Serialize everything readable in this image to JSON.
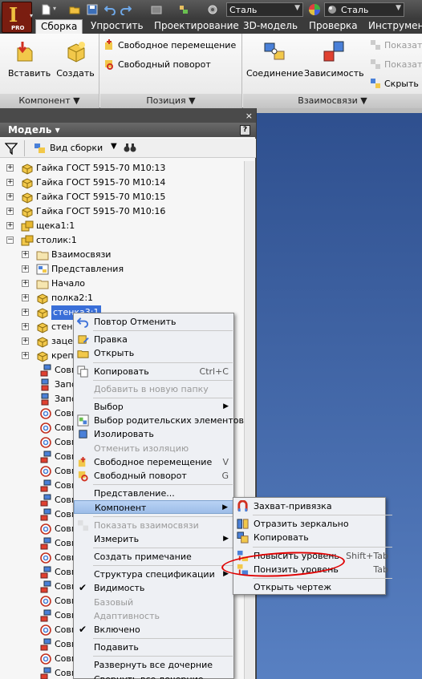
{
  "logo": {
    "letter": "I",
    "badge": "PRO"
  },
  "quick_access": {
    "material_combo": "Сталь",
    "appearance_combo": "Сталь"
  },
  "tabs": [
    "Сборка",
    "Упростить",
    "Проектирование",
    "3D-модель",
    "Проверка",
    "Инструмент"
  ],
  "ribbon": {
    "panel_component": {
      "label": "Компонент ▼",
      "insert": "Вставить",
      "create": "Создать"
    },
    "panel_position": {
      "label": "Позиция ▼",
      "free_move": "Свободное перемещение",
      "free_rotate": "Свободный поворот"
    },
    "panel_relations": {
      "label": "Взаимосвязи ▼",
      "joint": "Соединение",
      "constraint": "Зависимость",
      "show": "Показат",
      "show2": "Показат",
      "hide": "Скрыть"
    }
  },
  "browser": {
    "title": "Модель ▾",
    "close": "×",
    "help": "?",
    "view_label": "Вид сборки",
    "tree": [
      {
        "label": "Гайка ГОСТ 5915-70 М10:13",
        "level": 0,
        "icon": "part-icon"
      },
      {
        "label": "Гайка ГОСТ 5915-70 М10:14",
        "level": 0,
        "icon": "part-icon"
      },
      {
        "label": "Гайка ГОСТ 5915-70 М10:15",
        "level": 0,
        "icon": "part-icon"
      },
      {
        "label": "Гайка ГОСТ 5915-70 М10:16",
        "level": 0,
        "icon": "part-icon"
      },
      {
        "label": "щека1:1",
        "level": 0,
        "icon": "assembly-icon"
      },
      {
        "label": "столик:1",
        "level": 0,
        "icon": "assembly-icon",
        "expanded": true
      },
      {
        "label": "Взаимосвязи",
        "level": 1,
        "icon": "folder-icon"
      },
      {
        "label": "Представления",
        "level": 1,
        "icon": "representations-icon"
      },
      {
        "label": "Начало",
        "level": 1,
        "icon": "folder-icon"
      },
      {
        "label": "полка2:1",
        "level": 1,
        "icon": "part-icon"
      },
      {
        "label": "стенка3:1",
        "level": 1,
        "icon": "part-icon",
        "selected": true
      },
      {
        "label": "стен",
        "level": 1,
        "icon": "part-icon"
      },
      {
        "label": "зацеп",
        "level": 1,
        "icon": "part-icon"
      },
      {
        "label": "крепл",
        "level": 1,
        "icon": "part-icon"
      },
      {
        "label": "Совм",
        "level": 2,
        "icon": "mate-icon"
      },
      {
        "label": "Запол",
        "level": 2,
        "icon": "flush-icon"
      },
      {
        "label": "Запол",
        "level": 2,
        "icon": "flush-icon"
      },
      {
        "label": "Совм",
        "level": 2,
        "icon": "insert-constraint-icon"
      },
      {
        "label": "Совм",
        "level": 2,
        "icon": "insert-constraint-icon"
      },
      {
        "label": "Совм",
        "level": 2,
        "icon": "insert-constraint-icon"
      },
      {
        "label": "Совм",
        "level": 2,
        "icon": "mate-icon"
      },
      {
        "label": "Совм",
        "level": 2,
        "icon": "insert-constraint-icon"
      },
      {
        "label": "Совм",
        "level": 2,
        "icon": "mate-icon"
      },
      {
        "label": "Совм",
        "level": 2,
        "icon": "mate-icon"
      },
      {
        "label": "Совм",
        "level": 2,
        "icon": "mate-icon"
      },
      {
        "label": "Совм",
        "level": 2,
        "icon": "insert-constraint-icon"
      },
      {
        "label": "Совм",
        "level": 2,
        "icon": "mate-icon"
      },
      {
        "label": "Совм",
        "level": 2,
        "icon": "insert-constraint-icon"
      },
      {
        "label": "Совм",
        "level": 2,
        "icon": "mate-icon"
      },
      {
        "label": "Совм",
        "level": 2,
        "icon": "mate-icon"
      },
      {
        "label": "Совм",
        "level": 2,
        "icon": "insert-constraint-icon"
      },
      {
        "label": "Совм",
        "level": 2,
        "icon": "mate-icon"
      },
      {
        "label": "Совм",
        "level": 2,
        "icon": "insert-constraint-icon"
      },
      {
        "label": "Совм",
        "level": 2,
        "icon": "mate-icon"
      },
      {
        "label": "Совм",
        "level": 2,
        "icon": "insert-constraint-icon"
      },
      {
        "label": "Совм",
        "level": 2,
        "icon": "mate-icon"
      },
      {
        "label": "Совм",
        "level": 2,
        "icon": "mate-icon"
      }
    ]
  },
  "context_menu": {
    "items": [
      {
        "label": "Повтор Отменить",
        "icon": "undo-icon"
      },
      {
        "sep": true
      },
      {
        "label": "Правка",
        "icon": "edit-icon"
      },
      {
        "label": "Открыть",
        "icon": "open-icon"
      },
      {
        "sep": true
      },
      {
        "label": "Копировать",
        "shortcut": "Ctrl+C",
        "icon": "copy-icon"
      },
      {
        "sep": true
      },
      {
        "label": "Добавить в новую папку",
        "disabled": true
      },
      {
        "sep": true
      },
      {
        "label": "Выбор",
        "submenu": true
      },
      {
        "label": "Выбор родительских элементов",
        "icon": "select-parents-icon"
      },
      {
        "label": "Изолировать",
        "icon": "isolate-icon"
      },
      {
        "label": "Отменить изоляцию",
        "disabled": true
      },
      {
        "label": "Свободное перемещение",
        "shortcut": "V",
        "icon": "free-move-icon"
      },
      {
        "label": "Свободный поворот",
        "shortcut": "G",
        "icon": "free-rotate-icon"
      },
      {
        "sep": true
      },
      {
        "label": "Представление...",
        "icon": ""
      },
      {
        "label": "Компонент",
        "submenu": true,
        "highlighted": true
      },
      {
        "sep": true
      },
      {
        "label": "Показать взаимосвязи",
        "disabled": true,
        "icon": "show-relations-icon"
      },
      {
        "label": "Измерить",
        "submenu": true
      },
      {
        "sep": true
      },
      {
        "label": "Создать примечание"
      },
      {
        "sep": true
      },
      {
        "label": "Структура спецификации",
        "submenu": true
      },
      {
        "label": "Видимость",
        "checked": true
      },
      {
        "label": "Базовый",
        "disabled": true
      },
      {
        "label": "Адаптивность",
        "disabled": true
      },
      {
        "label": "Включено",
        "checked": true
      },
      {
        "sep": true
      },
      {
        "label": "Подавить"
      },
      {
        "sep": true
      },
      {
        "label": "Развернуть все дочерние"
      },
      {
        "label": "Свернуть все дочерние"
      }
    ]
  },
  "submenu": {
    "items": [
      {
        "label": "Захват-привязка",
        "icon": "grip-snap-icon"
      },
      {
        "sep": true
      },
      {
        "label": "Отразить зеркально",
        "icon": "mirror-icon"
      },
      {
        "label": "Копировать",
        "icon": "copy-component-icon"
      },
      {
        "sep": true
      },
      {
        "label": "Повысить уровень",
        "shortcut": "Shift+Tab",
        "icon": "promote-icon"
      },
      {
        "label": "Понизить уровень",
        "shortcut": "Tab",
        "icon": "demote-icon"
      },
      {
        "sep": true
      },
      {
        "label": "Открыть чертеж"
      }
    ]
  },
  "colors": {
    "accent": "#3a6fd8",
    "annotation": "#e00000",
    "viewport": "#4a72b8"
  }
}
